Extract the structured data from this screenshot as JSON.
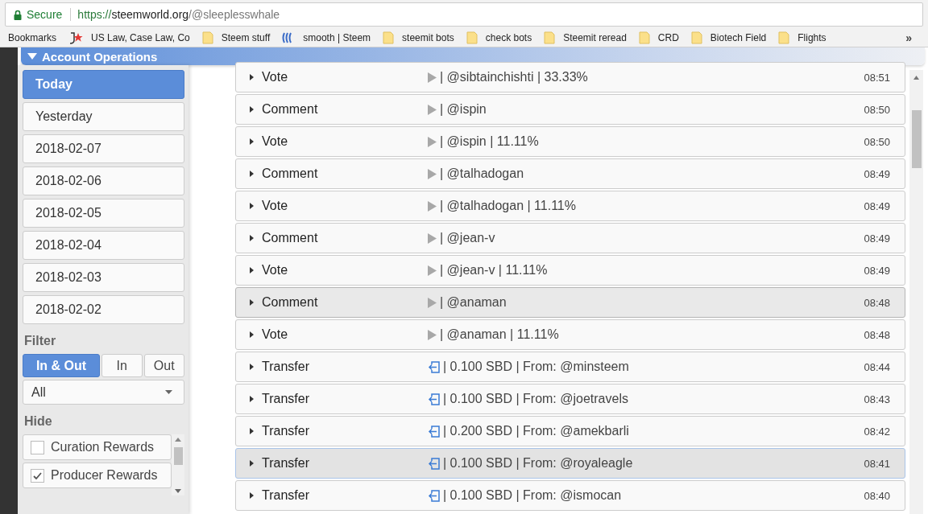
{
  "address_bar": {
    "secure_label": "Secure",
    "url_scheme": "https://",
    "url_host": "steemworld.org",
    "url_path": "/@sleeplesswhale"
  },
  "bookmarks": [
    {
      "kind": "apps",
      "label": "Bookmarks"
    },
    {
      "kind": "jstar",
      "label": "US Law, Case Law, Co"
    },
    {
      "kind": "folder",
      "label": "Steem stuff"
    },
    {
      "kind": "steem",
      "label": "smooth | Steem"
    },
    {
      "kind": "folder",
      "label": "steemit bots"
    },
    {
      "kind": "folder",
      "label": "check bots"
    },
    {
      "kind": "folder",
      "label": "Steemit reread"
    },
    {
      "kind": "folder",
      "label": "CRD"
    },
    {
      "kind": "folder",
      "label": "Biotech Field"
    },
    {
      "kind": "folder",
      "label": "Flights"
    }
  ],
  "bookmarks_more": "»",
  "section": {
    "title": "Account Operations"
  },
  "sidebar": {
    "days": [
      {
        "label": "Today",
        "selected": true
      },
      {
        "label": "Yesterday",
        "selected": false
      },
      {
        "label": "2018-02-07",
        "selected": false
      },
      {
        "label": "2018-02-06",
        "selected": false
      },
      {
        "label": "2018-02-05",
        "selected": false
      },
      {
        "label": "2018-02-04",
        "selected": false
      },
      {
        "label": "2018-02-03",
        "selected": false
      },
      {
        "label": "2018-02-02",
        "selected": false
      }
    ],
    "filter_label": "Filter",
    "filter_buttons": [
      {
        "label": "In & Out",
        "selected": true
      },
      {
        "label": "In",
        "selected": false
      },
      {
        "label": "Out",
        "selected": false
      }
    ],
    "filter_select": {
      "value": "All"
    },
    "hide_label": "Hide",
    "hide_options": [
      {
        "label": "Curation Rewards",
        "checked": false
      },
      {
        "label": "Producer Rewards",
        "checked": true
      }
    ]
  },
  "operations": [
    {
      "kind": "vote",
      "type": "Vote",
      "detail": "| @sibtainchishti | 33.33%",
      "time": "08:51",
      "selected": false,
      "hovered": false
    },
    {
      "kind": "comment",
      "type": "Comment",
      "detail": "| @ispin",
      "time": "08:50",
      "selected": false,
      "hovered": false
    },
    {
      "kind": "vote",
      "type": "Vote",
      "detail": "| @ispin | 11.11%",
      "time": "08:50",
      "selected": false,
      "hovered": false
    },
    {
      "kind": "comment",
      "type": "Comment",
      "detail": "| @talhadogan",
      "time": "08:49",
      "selected": false,
      "hovered": false
    },
    {
      "kind": "vote",
      "type": "Vote",
      "detail": "| @talhadogan | 11.11%",
      "time": "08:49",
      "selected": false,
      "hovered": false
    },
    {
      "kind": "comment",
      "type": "Comment",
      "detail": "| @jean-v",
      "time": "08:49",
      "selected": false,
      "hovered": false
    },
    {
      "kind": "vote",
      "type": "Vote",
      "detail": "| @jean-v | 11.11%",
      "time": "08:49",
      "selected": false,
      "hovered": false
    },
    {
      "kind": "comment",
      "type": "Comment",
      "detail": "| @anaman",
      "time": "08:48",
      "selected": false,
      "hovered": true
    },
    {
      "kind": "vote",
      "type": "Vote",
      "detail": "| @anaman | 11.11%",
      "time": "08:48",
      "selected": false,
      "hovered": false
    },
    {
      "kind": "transfer",
      "type": "Transfer",
      "detail": "| 0.100 SBD | From: @minsteem",
      "time": "08:44",
      "selected": false,
      "hovered": false
    },
    {
      "kind": "transfer",
      "type": "Transfer",
      "detail": "| 0.100 SBD | From: @joetravels",
      "time": "08:43",
      "selected": false,
      "hovered": false
    },
    {
      "kind": "transfer",
      "type": "Transfer",
      "detail": "| 0.200 SBD | From: @amekbarli",
      "time": "08:42",
      "selected": false,
      "hovered": false
    },
    {
      "kind": "transfer",
      "type": "Transfer",
      "detail": "| 0.100 SBD | From: @royaleagle",
      "time": "08:41",
      "selected": true,
      "hovered": false
    },
    {
      "kind": "transfer",
      "type": "Transfer",
      "detail": "| 0.100 SBD | From: @ismocan",
      "time": "08:40",
      "selected": false,
      "hovered": false
    }
  ]
}
